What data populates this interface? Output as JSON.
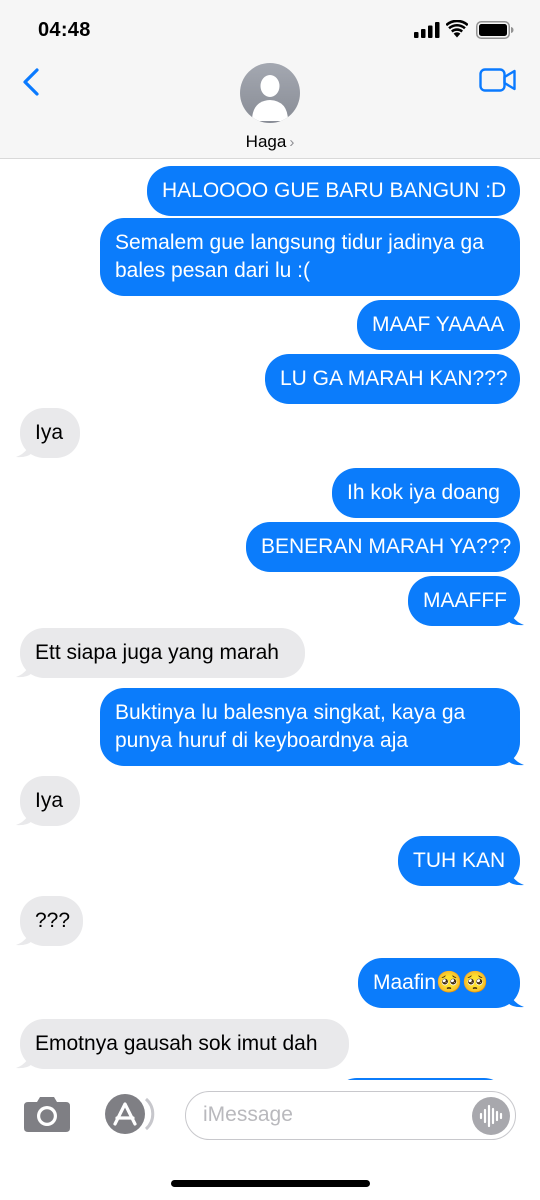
{
  "status_bar": {
    "time": "04:48"
  },
  "header": {
    "contact_name": "Haga",
    "chevron": "›"
  },
  "colors": {
    "outgoing": "#0b7cfb",
    "incoming": "#e9e9eb",
    "accent": "#0a7aff"
  },
  "messages": [
    {
      "direction": "out",
      "lines": [
        "HALOOOO GUE BARU BANGUN :D"
      ]
    },
    {
      "direction": "out",
      "lines": [
        "Semalem gue langsung tidur jadinya ga",
        "bales pesan dari lu :("
      ]
    },
    {
      "direction": "out",
      "lines": [
        "MAAF YAAAA"
      ]
    },
    {
      "direction": "out",
      "lines": [
        "LU GA MARAH KAN???"
      ]
    },
    {
      "direction": "in",
      "lines": [
        "Iya"
      ]
    },
    {
      "direction": "out",
      "lines": [
        "Ih kok iya doang"
      ]
    },
    {
      "direction": "out",
      "lines": [
        "BENERAN MARAH YA???"
      ]
    },
    {
      "direction": "out",
      "lines": [
        "MAAFFF"
      ]
    },
    {
      "direction": "in",
      "lines": [
        "Ett siapa juga yang marah"
      ]
    },
    {
      "direction": "out",
      "lines": [
        "Buktinya lu balesnya singkat, kaya ga",
        "punya huruf di keyboardnya aja"
      ]
    },
    {
      "direction": "in",
      "lines": [
        "Iya"
      ]
    },
    {
      "direction": "out",
      "lines": [
        "TUH KAN"
      ]
    },
    {
      "direction": "in",
      "lines": [
        "???"
      ]
    },
    {
      "direction": "out",
      "lines": [
        "Maafin🥺🥺"
      ]
    },
    {
      "direction": "in",
      "lines": [
        "Emotnya gausah sok imut dah"
      ]
    }
  ],
  "input": {
    "placeholder": "iMessage",
    "value": ""
  },
  "icons": {
    "back": "chevron-left-icon",
    "video": "video-camera-icon",
    "avatar": "person-silhouette-icon",
    "camera": "camera-icon",
    "apps": "app-store-icon",
    "audio": "audio-waveform-icon"
  }
}
